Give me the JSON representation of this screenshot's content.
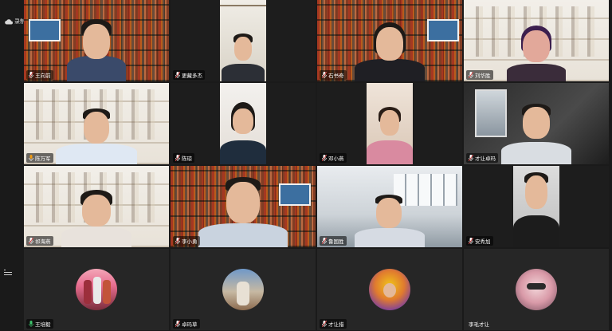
{
  "status": {
    "recording_label": "录制中"
  },
  "participants": [
    {
      "name": "王向前",
      "mic": "muted"
    },
    {
      "name": "更藏多杰",
      "mic": "muted"
    },
    {
      "name": "石书奇",
      "mic": "muted"
    },
    {
      "name": "刘华胜",
      "mic": "muted"
    },
    {
      "name": "陈万军",
      "mic": "active"
    },
    {
      "name": "陈琼",
      "mic": "muted"
    },
    {
      "name": "邓小燕",
      "mic": "muted"
    },
    {
      "name": "才让卓玛",
      "mic": "muted"
    },
    {
      "name": "祁海燕",
      "mic": "muted"
    },
    {
      "name": "李小勇",
      "mic": "muted"
    },
    {
      "name": "鲁国胜",
      "mic": "muted"
    },
    {
      "name": "安秀加",
      "mic": "muted"
    },
    {
      "name": "王培毅",
      "mic": "active"
    },
    {
      "name": "卓玛草",
      "mic": "muted"
    },
    {
      "name": "才让措",
      "mic": "muted"
    },
    {
      "name": "李毛才让",
      "mic": "none"
    }
  ],
  "colors": {
    "active_speaker_border": "#3cc36b",
    "mic_active": "#3cc36b",
    "mic_muted": "#e04b4b",
    "background": "#1a1a1a"
  }
}
